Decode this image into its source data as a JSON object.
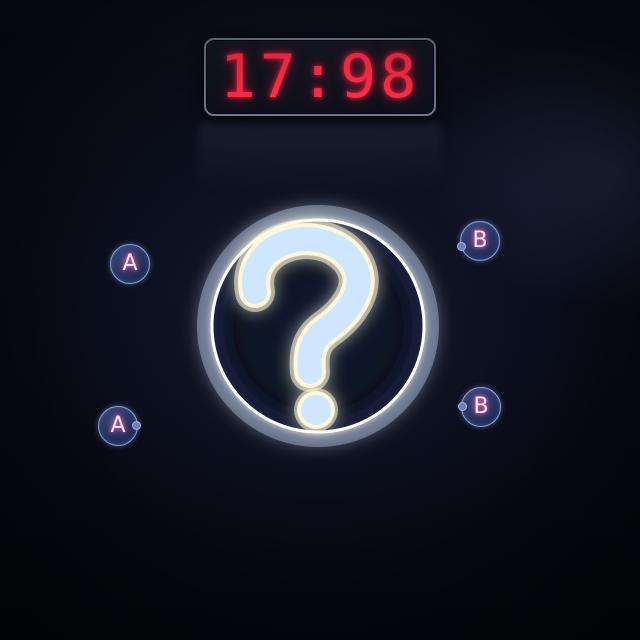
{
  "timer": {
    "display": "17:98",
    "color": "#ff2b45"
  },
  "question": {
    "symbol": "?",
    "ring_color": "#ffffff",
    "fill_color": "#cfe6ff"
  },
  "answers": [
    {
      "label": "A"
    },
    {
      "label": "A"
    },
    {
      "label": "B"
    },
    {
      "label": "B"
    }
  ],
  "colors": {
    "background": "#090c16",
    "button_fill": "#1d2850",
    "button_border": "#8ea1d8",
    "label_glow": "#ff5fa8"
  }
}
